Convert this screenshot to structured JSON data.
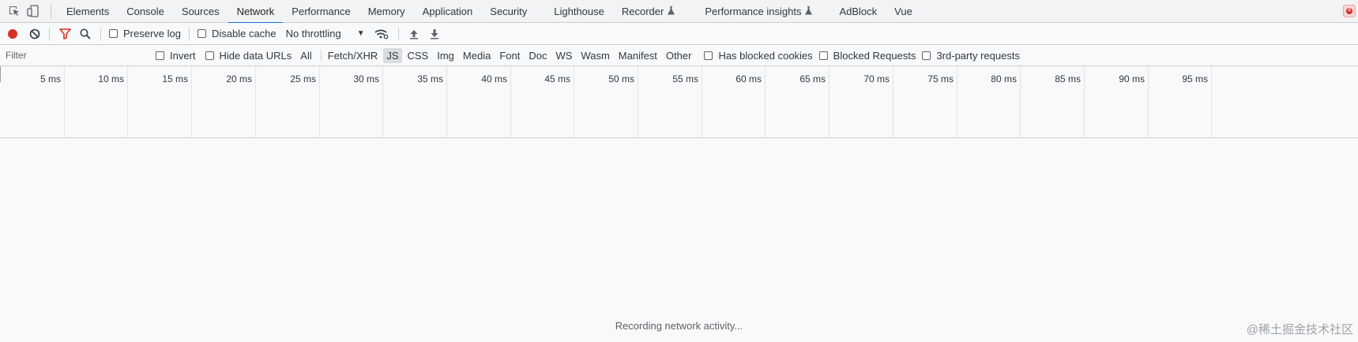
{
  "tabbar": {
    "tabs": [
      {
        "label": "Elements",
        "active": false
      },
      {
        "label": "Console",
        "active": false
      },
      {
        "label": "Sources",
        "active": false
      },
      {
        "label": "Network",
        "active": true
      },
      {
        "label": "Performance",
        "active": false
      },
      {
        "label": "Memory",
        "active": false
      },
      {
        "label": "Application",
        "active": false
      },
      {
        "label": "Security",
        "active": false
      },
      {
        "label": "Lighthouse",
        "active": false
      },
      {
        "label": "Recorder",
        "active": false,
        "experimental": true
      },
      {
        "label": "Performance insights",
        "active": false,
        "experimental": true
      },
      {
        "label": "AdBlock",
        "active": false
      },
      {
        "label": "Vue",
        "active": false
      }
    ]
  },
  "toolbar": {
    "preserve_log": "Preserve log",
    "disable_cache": "Disable cache",
    "throttling": "No throttling"
  },
  "filterbar": {
    "placeholder": "Filter",
    "invert": "Invert",
    "hide_data_urls": "Hide data URLs",
    "types": [
      {
        "label": "All",
        "active": false
      },
      {
        "label": "Fetch/XHR",
        "active": false
      },
      {
        "label": "JS",
        "active": true
      },
      {
        "label": "CSS",
        "active": false
      },
      {
        "label": "Img",
        "active": false
      },
      {
        "label": "Media",
        "active": false
      },
      {
        "label": "Font",
        "active": false
      },
      {
        "label": "Doc",
        "active": false
      },
      {
        "label": "WS",
        "active": false
      },
      {
        "label": "Wasm",
        "active": false
      },
      {
        "label": "Manifest",
        "active": false
      },
      {
        "label": "Other",
        "active": false
      }
    ],
    "has_blocked_cookies": "Has blocked cookies",
    "blocked_requests": "Blocked Requests",
    "third_party": "3rd-party requests"
  },
  "overview": {
    "ticks": [
      "5 ms",
      "10 ms",
      "15 ms",
      "20 ms",
      "25 ms",
      "30 ms",
      "35 ms",
      "40 ms",
      "45 ms",
      "50 ms",
      "55 ms",
      "60 ms",
      "65 ms",
      "70 ms",
      "75 ms",
      "80 ms",
      "85 ms",
      "90 ms",
      "95 ms"
    ]
  },
  "status": {
    "message": "Recording network activity..."
  },
  "watermark": "@稀土掘金技术社区",
  "colors": {
    "accent": "#1a73e8",
    "record": "#d93025",
    "filter_icon": "#d93025"
  }
}
